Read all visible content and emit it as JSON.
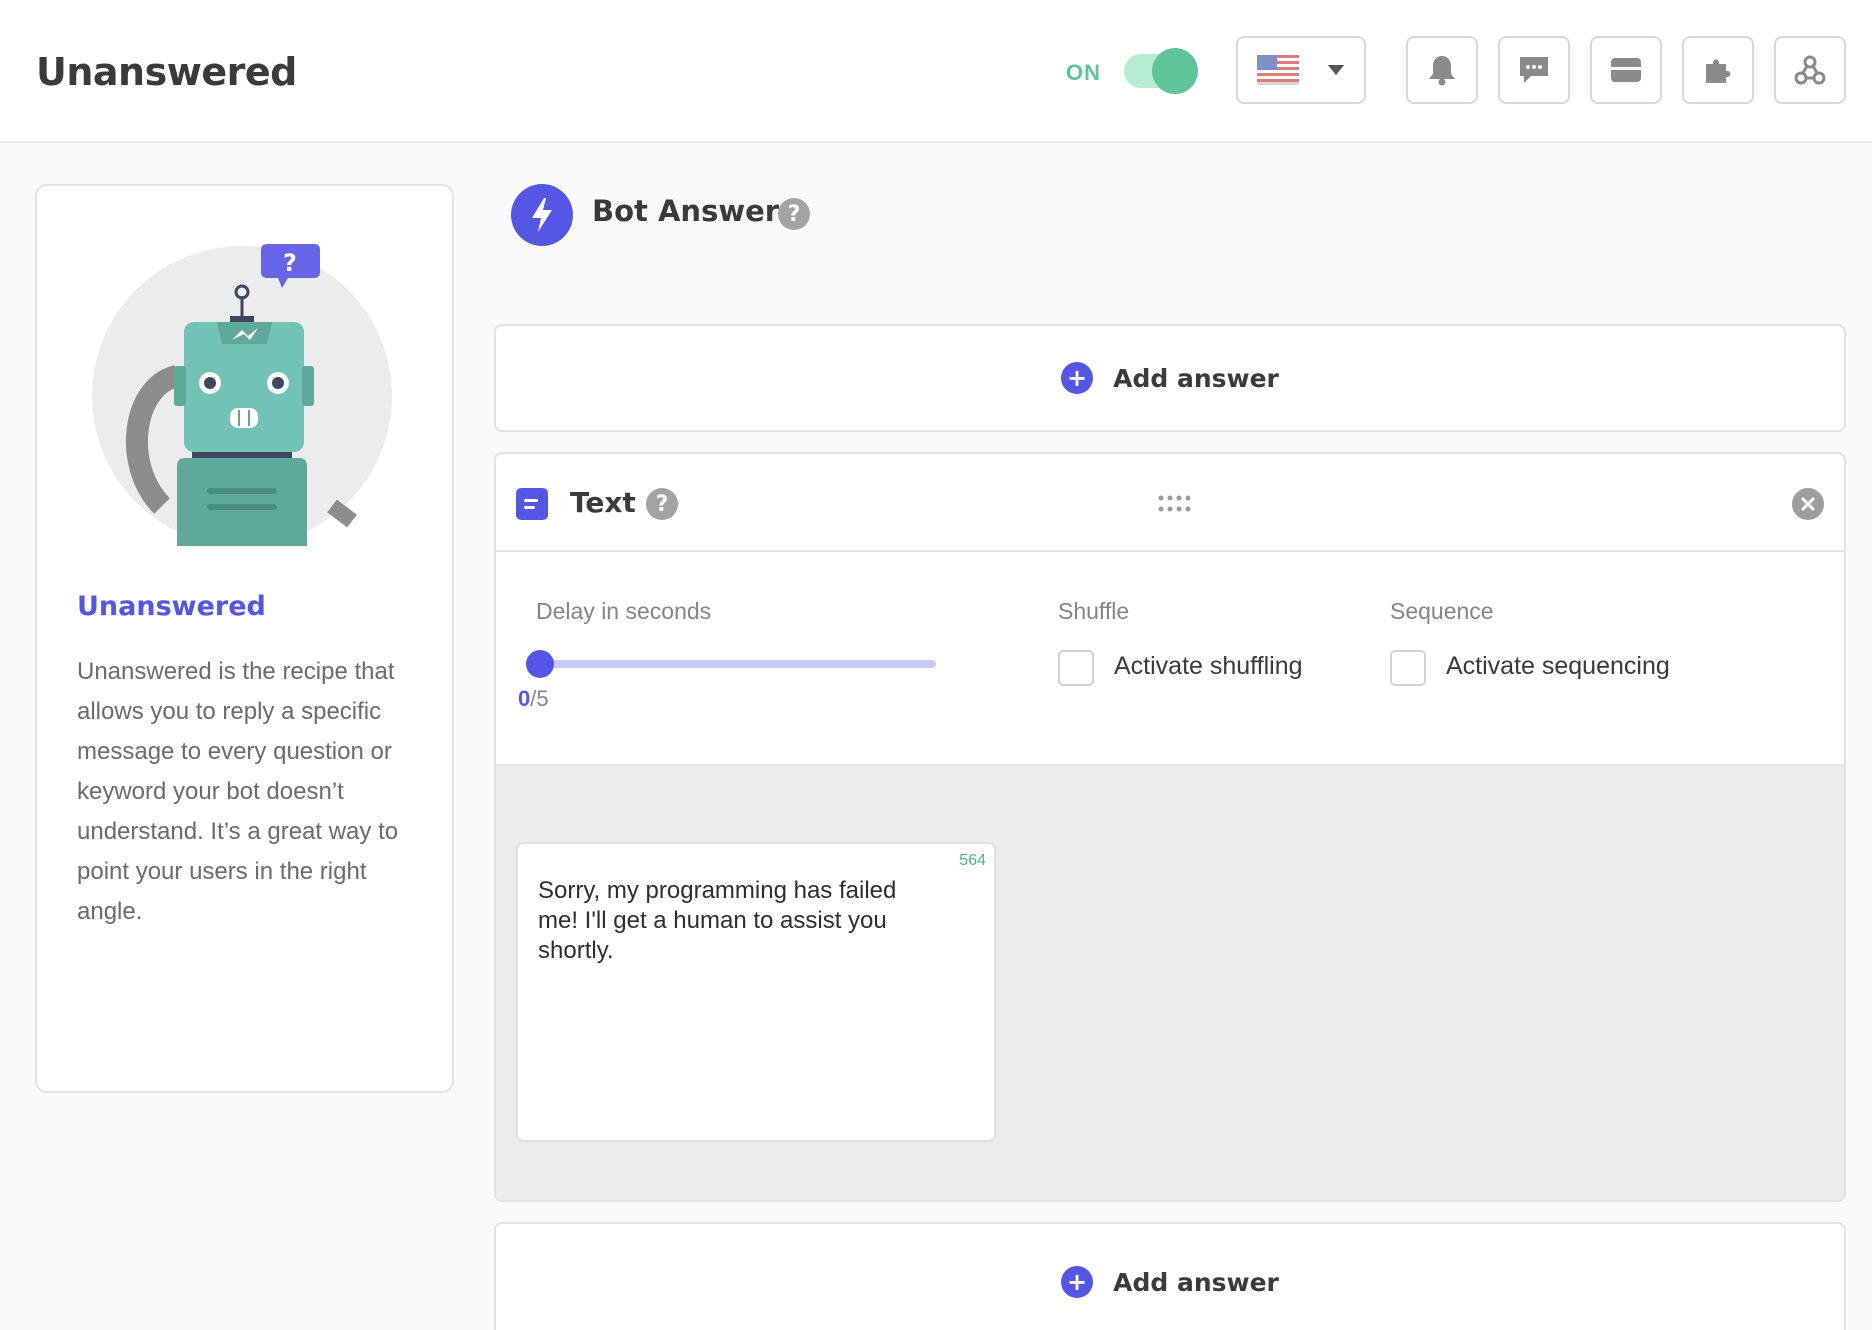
{
  "header": {
    "title": "Unanswered",
    "toggle_label": "ON",
    "toggle_state": "on",
    "language_flag": "us-flag",
    "icons": [
      "bell-icon",
      "chat-icon",
      "inbox-icon",
      "puzzle-icon",
      "webhook-icon"
    ],
    "colors": {
      "toggle_on": "#5ec59b",
      "accent": "#5456e5"
    }
  },
  "info_card": {
    "illustration": "robot-question-illustration",
    "title": "Unanswered",
    "description": "Unanswered is the recipe that allows you to reply a specific message to every question or keyword your bot doesn’t understand. It’s a great way to point your users in the right angle."
  },
  "bot_answers": {
    "title": "Bot Answers",
    "help": "?",
    "add_answer_label": "Add answer",
    "add_answer_plus": "+"
  },
  "text_card": {
    "title": "Text",
    "help": "?",
    "delay": {
      "label": "Delay in seconds",
      "current": "0",
      "max_text": "/5",
      "value": 0,
      "max": 5
    },
    "shuffle": {
      "label": "Shuffle",
      "checkbox_label": "Activate shuffling",
      "checked": false
    },
    "sequence": {
      "label": "Sequence",
      "checkbox_label": "Activate sequencing",
      "checked": false
    },
    "message": {
      "char_count": "564",
      "text": "Sorry, my programming has failed me! I'll get a human to assist you shortly."
    }
  }
}
